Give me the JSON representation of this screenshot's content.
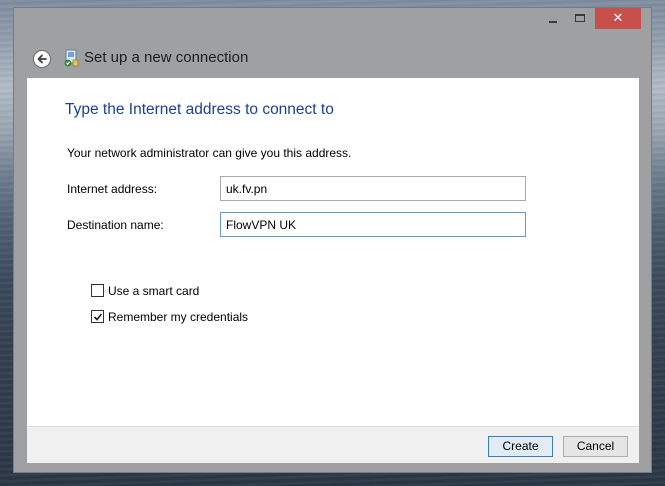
{
  "window": {
    "controls": {
      "close_glyph": "✕"
    }
  },
  "header": {
    "title": "Set up a new connection",
    "back_icon": "back-arrow-icon",
    "app_icon": "network-connection-icon"
  },
  "content": {
    "heading": "Type the Internet address to connect to",
    "description": "Your network administrator can give you this address.",
    "fields": {
      "internet_address": {
        "label": "Internet address:",
        "value": "uk.fv.pn"
      },
      "destination_name": {
        "label": "Destination name:",
        "value": "FlowVPN UK"
      }
    },
    "options": {
      "smart_card": {
        "label": "Use a smart card",
        "checked": false
      },
      "remember_credentials": {
        "label": "Remember my credentials",
        "checked": true
      }
    }
  },
  "footer": {
    "create_label": "Create",
    "cancel_label": "Cancel"
  },
  "colors": {
    "heading": "#1c3f94",
    "close_button": "#c7504c",
    "focus_border": "#5f9bd1"
  }
}
